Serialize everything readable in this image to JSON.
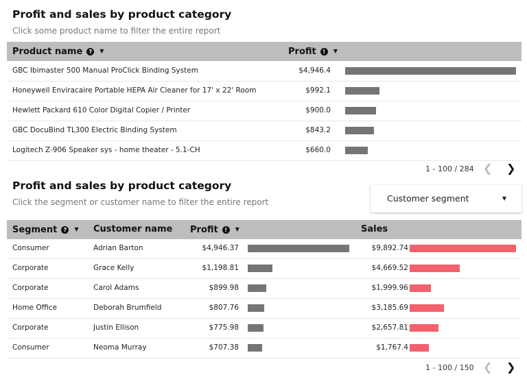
{
  "section1": {
    "title": "Profit and sales by product category",
    "subtitle": "Click some product name to filter the entire report",
    "columns": {
      "product": "Product name",
      "profit": "Profit"
    },
    "rows": [
      {
        "product": "GBC Ibimaster 500 Manual ProClick Binding System",
        "profit": "$4,946.4",
        "profit_value": 4946.4
      },
      {
        "product": "Honeywell Enviracaire Portable HEPA Air Cleaner for 17' x 22' Room",
        "profit": "$992.1",
        "profit_value": 992.1
      },
      {
        "product": "Hewlett Packard 610 Color Digital Copier / Printer",
        "profit": "$900.0",
        "profit_value": 900.0
      },
      {
        "product": "GBC DocuBind TL300 Electric Binding System",
        "profit": "$843.2",
        "profit_value": 843.2
      },
      {
        "product": "Logitech Z-906 Speaker sys - home theater - 5.1-CH",
        "profit": "$660.0",
        "profit_value": 660.0
      }
    ],
    "pager": "1 - 100 / 284"
  },
  "section2": {
    "title": "Profit and sales by product category",
    "subtitle": "Click the segment or customer name to filter the entire report",
    "filter": {
      "label": "Customer segment"
    },
    "columns": {
      "segment": "Segment",
      "customer": "Customer name",
      "profit": "Profit",
      "sales": "Sales"
    },
    "rows": [
      {
        "segment": "Consumer",
        "customer": "Adrian Barton",
        "profit": "$4,946.37",
        "profit_value": 4946.37,
        "sales": "$9,892.74",
        "sales_value": 9892.74
      },
      {
        "segment": "Corporate",
        "customer": "Grace Kelly",
        "profit": "$1,198.81",
        "profit_value": 1198.81,
        "sales": "$4,669.52",
        "sales_value": 4669.52
      },
      {
        "segment": "Corporate",
        "customer": "Carol Adams",
        "profit": "$899.98",
        "profit_value": 899.98,
        "sales": "$1,999.96",
        "sales_value": 1999.96
      },
      {
        "segment": "Home Office",
        "customer": "Deborah Brumfield",
        "profit": "$807.76",
        "profit_value": 807.76,
        "sales": "$3,185.69",
        "sales_value": 3185.69
      },
      {
        "segment": "Corporate",
        "customer": "Justin Ellison",
        "profit": "$775.98",
        "profit_value": 775.98,
        "sales": "$2,657.81",
        "sales_value": 2657.81
      },
      {
        "segment": "Consumer",
        "customer": "Neoma Murray",
        "profit": "$707.38",
        "profit_value": 707.38,
        "sales": "$1,767.4",
        "sales_value": 1767.4
      }
    ],
    "pager": "1 - 100 / 150"
  },
  "colors": {
    "profit_bar": "#757575",
    "sales_bar": "#f4606c",
    "header_bg": "#bdbdbd"
  },
  "icons": {
    "help": "help-circle-icon",
    "sort": "caret-down-icon",
    "prev": "chevron-left-icon",
    "next": "chevron-right-icon"
  }
}
